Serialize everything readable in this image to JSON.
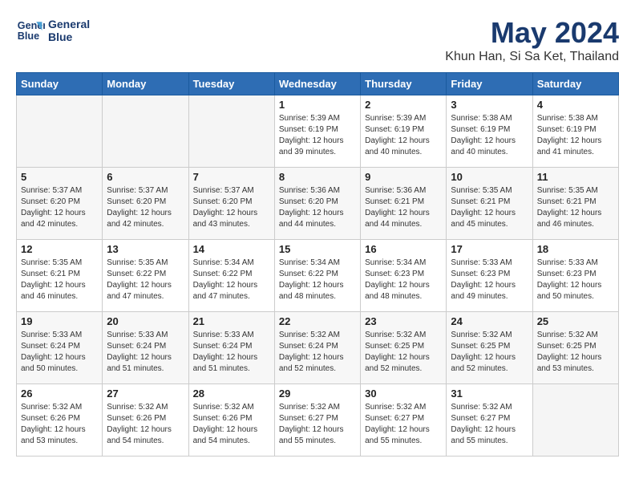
{
  "header": {
    "logo_line1": "General",
    "logo_line2": "Blue",
    "title": "May 2024",
    "subtitle": "Khun Han, Si Sa Ket, Thailand"
  },
  "weekdays": [
    "Sunday",
    "Monday",
    "Tuesday",
    "Wednesday",
    "Thursday",
    "Friday",
    "Saturday"
  ],
  "weeks": [
    [
      {
        "day": "",
        "empty": true
      },
      {
        "day": "",
        "empty": true
      },
      {
        "day": "",
        "empty": true
      },
      {
        "day": "1",
        "sunrise": "5:39 AM",
        "sunset": "6:19 PM",
        "daylight": "12 hours and 39 minutes."
      },
      {
        "day": "2",
        "sunrise": "5:39 AM",
        "sunset": "6:19 PM",
        "daylight": "12 hours and 40 minutes."
      },
      {
        "day": "3",
        "sunrise": "5:38 AM",
        "sunset": "6:19 PM",
        "daylight": "12 hours and 40 minutes."
      },
      {
        "day": "4",
        "sunrise": "5:38 AM",
        "sunset": "6:19 PM",
        "daylight": "12 hours and 41 minutes."
      }
    ],
    [
      {
        "day": "5",
        "sunrise": "5:37 AM",
        "sunset": "6:20 PM",
        "daylight": "12 hours and 42 minutes."
      },
      {
        "day": "6",
        "sunrise": "5:37 AM",
        "sunset": "6:20 PM",
        "daylight": "12 hours and 42 minutes."
      },
      {
        "day": "7",
        "sunrise": "5:37 AM",
        "sunset": "6:20 PM",
        "daylight": "12 hours and 43 minutes."
      },
      {
        "day": "8",
        "sunrise": "5:36 AM",
        "sunset": "6:20 PM",
        "daylight": "12 hours and 44 minutes."
      },
      {
        "day": "9",
        "sunrise": "5:36 AM",
        "sunset": "6:21 PM",
        "daylight": "12 hours and 44 minutes."
      },
      {
        "day": "10",
        "sunrise": "5:35 AM",
        "sunset": "6:21 PM",
        "daylight": "12 hours and 45 minutes."
      },
      {
        "day": "11",
        "sunrise": "5:35 AM",
        "sunset": "6:21 PM",
        "daylight": "12 hours and 46 minutes."
      }
    ],
    [
      {
        "day": "12",
        "sunrise": "5:35 AM",
        "sunset": "6:21 PM",
        "daylight": "12 hours and 46 minutes."
      },
      {
        "day": "13",
        "sunrise": "5:35 AM",
        "sunset": "6:22 PM",
        "daylight": "12 hours and 47 minutes."
      },
      {
        "day": "14",
        "sunrise": "5:34 AM",
        "sunset": "6:22 PM",
        "daylight": "12 hours and 47 minutes."
      },
      {
        "day": "15",
        "sunrise": "5:34 AM",
        "sunset": "6:22 PM",
        "daylight": "12 hours and 48 minutes."
      },
      {
        "day": "16",
        "sunrise": "5:34 AM",
        "sunset": "6:23 PM",
        "daylight": "12 hours and 48 minutes."
      },
      {
        "day": "17",
        "sunrise": "5:33 AM",
        "sunset": "6:23 PM",
        "daylight": "12 hours and 49 minutes."
      },
      {
        "day": "18",
        "sunrise": "5:33 AM",
        "sunset": "6:23 PM",
        "daylight": "12 hours and 50 minutes."
      }
    ],
    [
      {
        "day": "19",
        "sunrise": "5:33 AM",
        "sunset": "6:24 PM",
        "daylight": "12 hours and 50 minutes."
      },
      {
        "day": "20",
        "sunrise": "5:33 AM",
        "sunset": "6:24 PM",
        "daylight": "12 hours and 51 minutes."
      },
      {
        "day": "21",
        "sunrise": "5:33 AM",
        "sunset": "6:24 PM",
        "daylight": "12 hours and 51 minutes."
      },
      {
        "day": "22",
        "sunrise": "5:32 AM",
        "sunset": "6:24 PM",
        "daylight": "12 hours and 52 minutes."
      },
      {
        "day": "23",
        "sunrise": "5:32 AM",
        "sunset": "6:25 PM",
        "daylight": "12 hours and 52 minutes."
      },
      {
        "day": "24",
        "sunrise": "5:32 AM",
        "sunset": "6:25 PM",
        "daylight": "12 hours and 52 minutes."
      },
      {
        "day": "25",
        "sunrise": "5:32 AM",
        "sunset": "6:25 PM",
        "daylight": "12 hours and 53 minutes."
      }
    ],
    [
      {
        "day": "26",
        "sunrise": "5:32 AM",
        "sunset": "6:26 PM",
        "daylight": "12 hours and 53 minutes."
      },
      {
        "day": "27",
        "sunrise": "5:32 AM",
        "sunset": "6:26 PM",
        "daylight": "12 hours and 54 minutes."
      },
      {
        "day": "28",
        "sunrise": "5:32 AM",
        "sunset": "6:26 PM",
        "daylight": "12 hours and 54 minutes."
      },
      {
        "day": "29",
        "sunrise": "5:32 AM",
        "sunset": "6:27 PM",
        "daylight": "12 hours and 55 minutes."
      },
      {
        "day": "30",
        "sunrise": "5:32 AM",
        "sunset": "6:27 PM",
        "daylight": "12 hours and 55 minutes."
      },
      {
        "day": "31",
        "sunrise": "5:32 AM",
        "sunset": "6:27 PM",
        "daylight": "12 hours and 55 minutes."
      },
      {
        "day": "",
        "empty": true
      }
    ]
  ]
}
